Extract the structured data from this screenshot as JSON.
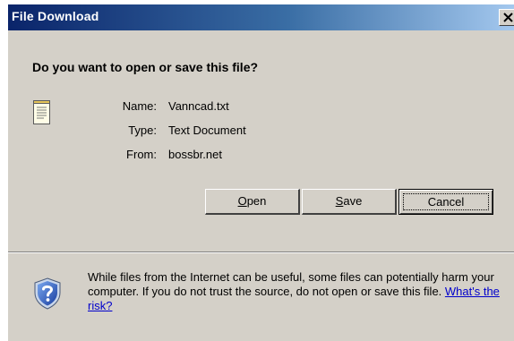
{
  "window": {
    "title": "File Download"
  },
  "dialog": {
    "question": "Do you want to open or save this file?",
    "file_icon": "text-document-icon",
    "info": {
      "name_label": "Name:",
      "name_value": "Vanncad.txt",
      "type_label": "Type:",
      "type_value": "Text Document",
      "from_label": "From:",
      "from_value": "bossbr.net"
    },
    "buttons": {
      "open_accel": "O",
      "open_rest": "pen",
      "save_accel": "S",
      "save_rest": "ave",
      "cancel": "Cancel"
    },
    "warning": {
      "icon": "security-shield-question-icon",
      "text": "While files from the Internet can be useful, some files can potentially harm your computer. If you do not trust the source, do not open or save this file.",
      "link": "What's the risk?"
    }
  },
  "colors": {
    "titlebar_start": "#0a246a",
    "titlebar_end": "#a6caf0",
    "dialog_bg": "#d4d0c8",
    "link": "#0000cc"
  }
}
